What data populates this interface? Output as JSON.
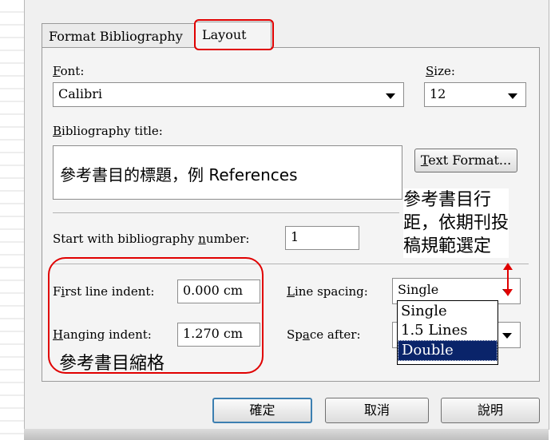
{
  "tabs": [
    {
      "label": "Format Bibliography"
    },
    {
      "label": "Layout"
    }
  ],
  "font": {
    "label_key": "F",
    "label_rest": "ont:",
    "value": "Calibri"
  },
  "size": {
    "label_key": "S",
    "label_rest": "ize:",
    "value": "12"
  },
  "bibliography_title": {
    "label_key": "B",
    "label_rest": "ibliography title:",
    "value": "參考書目的標題，例 References",
    "text_format_key": "T",
    "text_format_rest": "ext Format..."
  },
  "start_number": {
    "label_pre": "Start with bibliography ",
    "label_key": "n",
    "label_post": "umber:",
    "value": "1"
  },
  "first_line_indent": {
    "label_pre": "F",
    "label_key": "i",
    "label_post": "rst line indent:",
    "value": "0.000 cm"
  },
  "hanging_indent": {
    "label_key": "H",
    "label_rest": "anging indent:",
    "value": "1.270 cm"
  },
  "line_spacing": {
    "label_key": "L",
    "label_rest": "ine spacing:",
    "value": "Single",
    "options": [
      "Single",
      "1.5 Lines",
      "Double"
    ],
    "selected_option": "Double"
  },
  "space_after": {
    "label_pre": "Sp",
    "label_key": "a",
    "label_post": "ce after:"
  },
  "buttons": {
    "ok": "確定",
    "cancel": "取消",
    "help": "說明"
  },
  "annotations": {
    "spacing_note_1": "參考書目行",
    "spacing_note_2": "距，依期刊投",
    "spacing_note_3": "稿規範選定",
    "indent_note": "參考書目縮格"
  },
  "colors": {
    "highlight_red": "#e00000",
    "selection_blue": "#0a246a",
    "dialog_bg": "#f0f0f0"
  }
}
